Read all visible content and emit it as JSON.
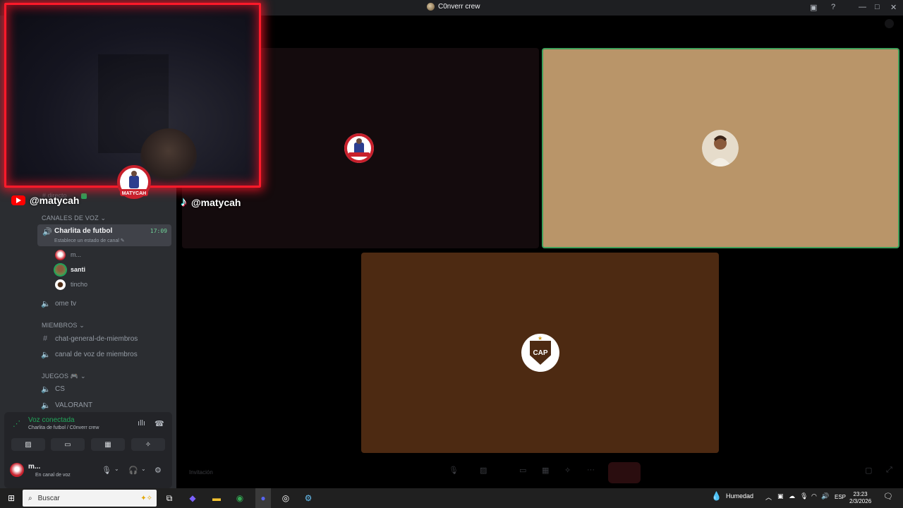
{
  "titlebar": {
    "server_name": "C0nverr crew"
  },
  "overlay": {
    "youtube_handle": "@matycah",
    "tiktok_handle": "@matycah",
    "ghost_channel": "directo"
  },
  "sidebar": {
    "voice_category": "CANALES DE VOZ",
    "active_channel": {
      "label": "Charlita de futbol",
      "time": "17:09",
      "status_hint": "Establece un estado de canal"
    },
    "voice_users": [
      {
        "name": "m..."
      },
      {
        "name": "santi"
      },
      {
        "name": "tincho"
      }
    ],
    "channel_ome": "ome tv",
    "members_category": "MIEMBROS",
    "members_channels": [
      "chat-general-de-miembros",
      "canal de voz de miembros"
    ],
    "games_category": "JUEGOS",
    "games_channels": [
      "CS",
      "VALORANT"
    ]
  },
  "voice_panel": {
    "title": "Voz conectada",
    "subtitle": "Charlita de futbol / C0nverr crew"
  },
  "user": {
    "name": "m...",
    "status": "En canal de voz"
  },
  "stage": {
    "invite_label": "Invitación"
  },
  "taskbar": {
    "search_placeholder": "Buscar",
    "weather": "Humedad",
    "lang": "ESP",
    "time": "23:23",
    "date": "2/3/2026"
  },
  "colors": {
    "sidebar_bg": "#2b2d31",
    "active_green": "#23a55a",
    "tile_tan": "#b99569",
    "tile_brown": "#4d2a12",
    "cam_border": "#ff1a2a"
  }
}
